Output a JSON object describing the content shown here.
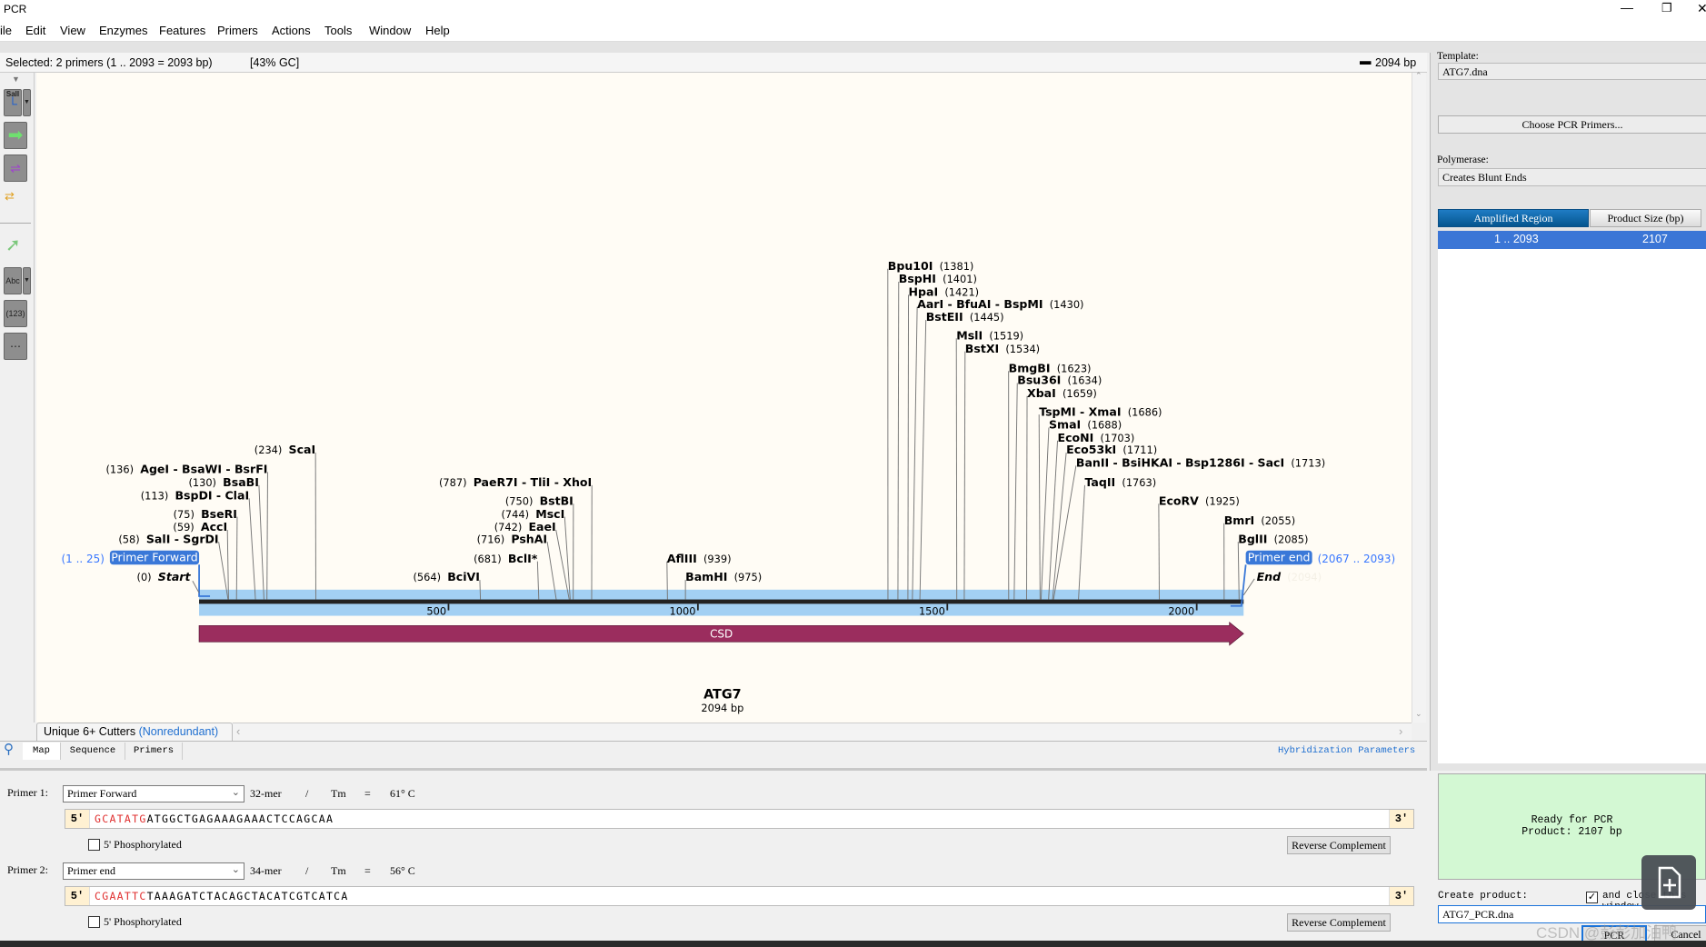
{
  "window": {
    "title": "PCR",
    "controls": [
      "minimize-icon",
      "restore-icon",
      "close-icon"
    ]
  },
  "menu": [
    "ile",
    "Edit",
    "View",
    "Enzymes",
    "Features",
    "Primers",
    "Actions",
    "Tools",
    "Window",
    "Help"
  ],
  "status": {
    "selected": "Selected:  2 primers  (1 .. 2093  =  2093 bp)",
    "gc": "[43% GC]",
    "length": "2094 bp"
  },
  "toolbar_left": {
    "enzyme_tool_label": "SalI",
    "abc_label": "Abc",
    "numbers_label": "(123)"
  },
  "map": {
    "title": "ATG7",
    "length": "2094 bp",
    "total_bp": 2094,
    "ticks": [
      500,
      1000,
      1500,
      2000
    ],
    "feature": {
      "name": "CSD",
      "start": 1,
      "end": 2094,
      "color": "#9b2d5e"
    },
    "start_label": {
      "name": "Start",
      "position": "(0)"
    },
    "end_label": {
      "name": "End",
      "position": "(2094)"
    },
    "primers": [
      {
        "name": "Primer Forward",
        "range": "(1 .. 25)"
      },
      {
        "name": "Primer end",
        "range": "(2067 .. 2093)"
      }
    ],
    "enzymes": [
      {
        "name": "ScaI",
        "position": 234
      },
      {
        "name": "AgeI - BsaWI - BsrFI",
        "position": 136
      },
      {
        "name": "BsaBI",
        "position": 130
      },
      {
        "name": "BspDI - ClaI",
        "position": 113
      },
      {
        "name": "BseRI",
        "position": 75
      },
      {
        "name": "AccI",
        "position": 59
      },
      {
        "name": "SalI - SgrDI",
        "position": 58
      },
      {
        "name": "PaeR7I - TliI - XhoI",
        "position": 787
      },
      {
        "name": "BstBI",
        "position": 750
      },
      {
        "name": "MscI",
        "position": 744
      },
      {
        "name": "EaeI",
        "position": 742
      },
      {
        "name": "PshAI",
        "position": 716
      },
      {
        "name": "BclI*",
        "position": 681
      },
      {
        "name": "BciVI",
        "position": 564
      },
      {
        "name": "AflIII",
        "position": 939
      },
      {
        "name": "BamHI",
        "position": 975
      },
      {
        "name": "Bpu10I",
        "position": 1381
      },
      {
        "name": "BspHI",
        "position": 1401
      },
      {
        "name": "HpaI",
        "position": 1421
      },
      {
        "name": "AarI - BfuAI - BspMI",
        "position": 1430
      },
      {
        "name": "BstEII",
        "position": 1445
      },
      {
        "name": "MslI",
        "position": 1519
      },
      {
        "name": "BstXI",
        "position": 1534
      },
      {
        "name": "BmgBI",
        "position": 1623
      },
      {
        "name": "Bsu36I",
        "position": 1634
      },
      {
        "name": "XbaI",
        "position": 1659
      },
      {
        "name": "TspMI - XmaI",
        "position": 1686
      },
      {
        "name": "SmaI",
        "position": 1688
      },
      {
        "name": "EcoNI",
        "position": 1703
      },
      {
        "name": "Eco53kI",
        "position": 1711
      },
      {
        "name": "BanII - BsiHKAI - Bsp1286I - SacI",
        "position": 1713
      },
      {
        "name": "TaqII",
        "position": 1763
      },
      {
        "name": "EcoRV",
        "position": 1925
      },
      {
        "name": "BmrI",
        "position": 2055
      },
      {
        "name": "BglII",
        "position": 2085
      }
    ],
    "colors": {
      "background": "#fffcf5",
      "band": "#a3d0f3",
      "primer": "#3a78d8"
    }
  },
  "bottom_tabs": {
    "enzyme_set": "Unique 6+ Cutters",
    "enzyme_set_mode": "(Nonredundant)",
    "tabs": [
      "Map",
      "Sequence",
      "Primers"
    ],
    "active": "Map",
    "hybridization": "Hybridization Parameters"
  },
  "primer1": {
    "label": "Primer 1:",
    "name": "Primer Forward",
    "length": "32-mer",
    "slash": "/",
    "tm_label": "Tm",
    "eq": "=",
    "tm": "61° C",
    "five": "5'",
    "three": "3'",
    "tail": "GCATATG",
    "seq": "ATGGCTGAGAAAGAAACTCCAGCAA",
    "phos_label": "5' Phosphorylated",
    "phosphorylated": false,
    "rc_button": "Reverse Complement"
  },
  "primer2": {
    "label": "Primer 2:",
    "name": "Primer end",
    "length": "34-mer",
    "slash": "/",
    "tm_label": "Tm",
    "eq": "=",
    "tm": "56° C",
    "five": "5'",
    "three": "3'",
    "tail": "CGAATTC",
    "seq": "TAAAGATCTACAGCTACATCGTCATCA",
    "phos_label": "5' Phosphorylated",
    "phosphorylated": false,
    "rc_button": "Reverse Complement"
  },
  "right": {
    "template_label": "Template:",
    "template": "ATG7.dna",
    "choose_button": "Choose PCR Primers...",
    "polymerase_label": "Polymerase:",
    "polymerase": "Creates Blunt Ends",
    "table": {
      "headers": [
        "Amplified Region",
        "Product Size (bp)"
      ],
      "rows": [
        [
          "1  ..  2093",
          "2107"
        ]
      ]
    },
    "ready": "Ready for PCR",
    "product": "Product:  2107 bp",
    "create_label": "Create product:",
    "close_label": "and close this window",
    "close_checked": true,
    "product_name": "ATG7_PCR.dna",
    "pcr_button": "PCR",
    "cancel_button": "Cancel"
  },
  "watermark": "CSDN @彭彭加油鸭"
}
